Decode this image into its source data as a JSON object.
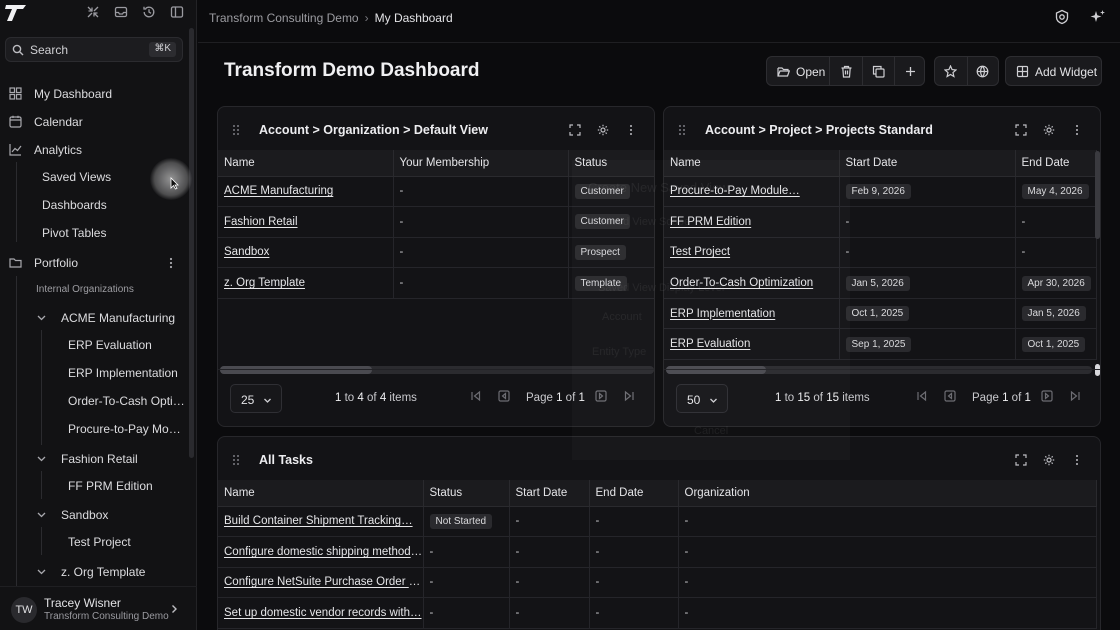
{
  "sidebar": {
    "search_placeholder": "Search",
    "search_shortcut": "⌘K",
    "items": {
      "my_dashboard": "My Dashboard",
      "calendar": "Calendar",
      "analytics": "Analytics",
      "saved_views": "Saved Views",
      "dashboards": "Dashboards",
      "pivot_tables": "Pivot Tables",
      "portfolio": "Portfolio",
      "internal_orgs": "Internal Organizations",
      "acme": "ACME Manufacturing",
      "erp_eval": "ERP Evaluation",
      "erp_impl": "ERP Implementation",
      "o2c": "Order-To-Cash Opti…",
      "p2p": "Procure-to-Pay Mo…",
      "fashion": "Fashion Retail",
      "ff_prm": "FF PRM Edition",
      "sandbox": "Sandbox",
      "test_project": "Test Project",
      "z_org": "z. Org Template"
    },
    "user": {
      "initials": "TW",
      "name": "Tracey Wisner",
      "org": "Transform Consulting Demo"
    }
  },
  "header": {
    "breadcrumb_root": "Transform Consulting Demo",
    "breadcrumb_current": "My Dashboard",
    "page_title": "Transform Demo Dashboard",
    "open_label": "Open",
    "add_widget_label": "Add Widget"
  },
  "widgets": {
    "org": {
      "title": "Account > Organization > Default View",
      "columns": [
        "Name",
        "Your Membership",
        "Status"
      ],
      "rows": [
        {
          "name": "ACME Manufacturing",
          "membership": "-",
          "status": "Customer"
        },
        {
          "name": "Fashion Retail",
          "membership": "-",
          "status": "Customer"
        },
        {
          "name": "Sandbox",
          "membership": "-",
          "status": "Prospect"
        },
        {
          "name": "z. Org Template",
          "membership": "-",
          "status": "Template"
        }
      ],
      "page_size": "25",
      "range_a": "1",
      "range_b": "4",
      "range_total": "4",
      "range_to": "to",
      "range_of": "of",
      "range_items": "items",
      "page_label": "Page",
      "page_num": "1",
      "page_of": "of",
      "page_total": "1"
    },
    "projects": {
      "title": "Account > Project > Projects Standard",
      "columns": [
        "Name",
        "Start Date",
        "End Date"
      ],
      "rows": [
        {
          "name": "Procure-to-Pay Module…",
          "start": "Feb 9, 2026",
          "end": "May 4, 2026"
        },
        {
          "name": "FF PRM Edition",
          "start": "-",
          "end": "-"
        },
        {
          "name": "Test Project",
          "start": "-",
          "end": "-"
        },
        {
          "name": "Order-To-Cash Optimization",
          "start": "Jan 5, 2026",
          "end": "Apr 30, 2026"
        },
        {
          "name": "ERP Implementation",
          "start": "Oct 1, 2025",
          "end": "Jan 5, 2026"
        },
        {
          "name": "ERP Evaluation",
          "start": "Sep 1, 2025",
          "end": "Oct 1, 2025"
        }
      ],
      "page_size": "50",
      "range_a": "1",
      "range_b": "15",
      "range_total": "15",
      "range_to": "to",
      "range_of": "of",
      "range_items": "items",
      "page_label": "Page",
      "page_num": "1",
      "page_of": "of",
      "page_total": "1"
    },
    "tasks": {
      "title": "All Tasks",
      "columns": [
        "Name",
        "Status",
        "Start Date",
        "End Date",
        "Organization"
      ],
      "rows": [
        {
          "name": "Build Container Shipment Tracking…",
          "status": "Not Started",
          "start": "-",
          "end": "-",
          "org": "-"
        },
        {
          "name": "Configure domestic shipping methods…",
          "status": "-",
          "start": "-",
          "end": "-",
          "org": "-"
        },
        {
          "name": "Configure NetSuite Purchase Order (P…",
          "status": "-",
          "start": "-",
          "end": "-",
          "org": "-"
        },
        {
          "name": "Set up domestic vendor records with…",
          "status": "-",
          "start": "-",
          "end": "-",
          "org": "-"
        }
      ]
    }
  },
  "modal_ghost": {
    "title": "Create New Saved View",
    "scope": "Saved View Scope",
    "level": "Saved View Display Level",
    "account": "Account",
    "entity": "Entity Type",
    "cancel": "Cancel"
  }
}
